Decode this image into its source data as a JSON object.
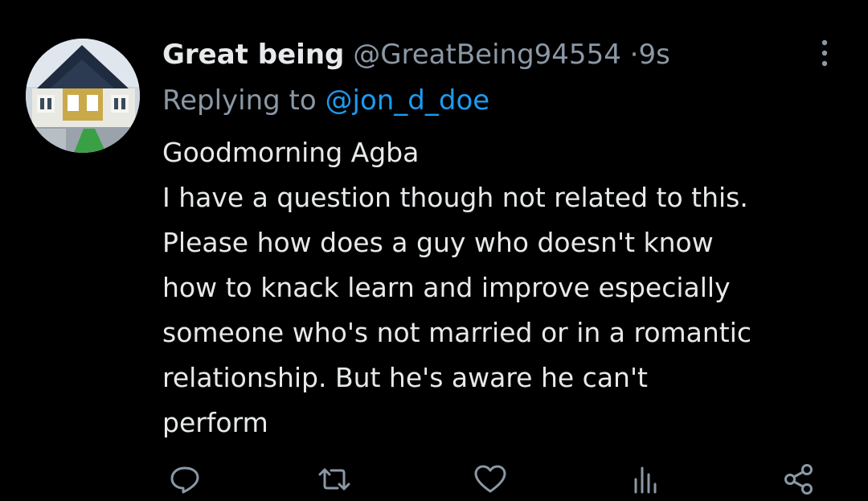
{
  "tweet": {
    "display_name": "Great being",
    "handle": "@GreatBeing94554",
    "separator": "·",
    "time": "9s",
    "replying_prefix": "Replying to",
    "replying_to": "@jon_d_doe",
    "text_lines": [
      "Goodmorning Agba",
      "I have a question though not related to this.",
      "Please how does a guy who doesn't know",
      "how to knack learn and improve especially",
      "someone who's not married or in a romantic",
      "relationship. But he's aware he can't",
      "perform"
    ]
  },
  "icons": {
    "avatar": "house-avatar",
    "more": "more-vertical-icon",
    "reply": "reply-icon",
    "retweet": "retweet-icon",
    "like": "like-icon",
    "views": "views-icon",
    "share": "share-icon"
  },
  "colors": {
    "background": "#000000",
    "primary_text": "#e7e9ea",
    "secondary_text": "#8b98a5",
    "link": "#1d9bf0"
  }
}
